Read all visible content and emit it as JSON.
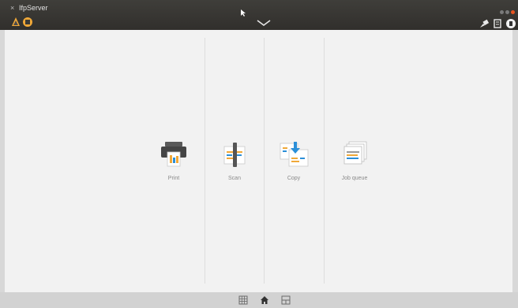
{
  "window": {
    "title": "IfpServer",
    "close_glyph": "×"
  },
  "titlebar": {
    "left_icons": [
      "tray-app-icon-1",
      "tray-app-icon-2"
    ],
    "center_icon": "chevron-down-icon",
    "right_icons": [
      "brush-icon",
      "document-icon",
      "power-icon"
    ],
    "window_dot_colors": [
      "#7a7a7a",
      "#7a7a7a",
      "#e95420"
    ]
  },
  "main": {
    "tiles": [
      {
        "label": "Print",
        "icon": "printer-icon"
      },
      {
        "label": "Scan",
        "icon": "scanner-icon"
      },
      {
        "label": "Copy",
        "icon": "copy-icon"
      },
      {
        "label": "Job queue",
        "icon": "job-queue-icon"
      }
    ]
  },
  "bottom_nav": {
    "items": [
      {
        "icon": "grid-icon"
      },
      {
        "icon": "home-icon",
        "active": true
      },
      {
        "icon": "split-view-icon"
      }
    ]
  },
  "colors": {
    "titlebar": "#35332f",
    "content_bg": "#f2f2f2",
    "accent_orange": "#f0a838",
    "accent_blue": "#2b8fd8",
    "bottom_bar": "#d2d2d2"
  }
}
